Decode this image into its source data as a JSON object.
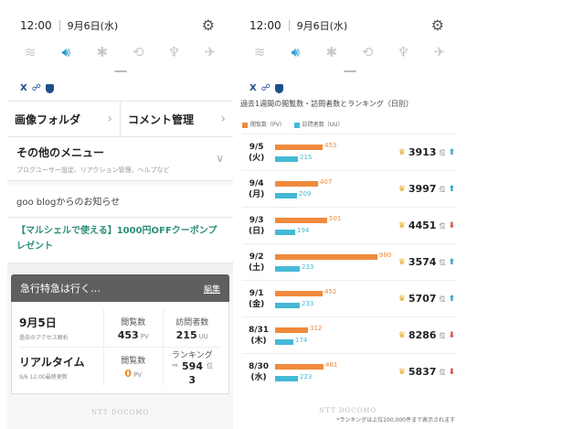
{
  "status": {
    "time": "12:00",
    "date": "9月6日(水)"
  },
  "quick_icons": [
    {
      "name": "wifi-icon",
      "glyph": "≋",
      "on": false
    },
    {
      "name": "sound-icon",
      "glyph": "🔊︎",
      "on": true
    },
    {
      "name": "bluetooth-icon",
      "glyph": "✱",
      "on": false
    },
    {
      "name": "rotate-icon",
      "glyph": "⟲",
      "on": false
    },
    {
      "name": "flashlight-icon",
      "glyph": "♆",
      "on": false
    },
    {
      "name": "airplane-icon",
      "glyph": "✈",
      "on": false
    }
  ],
  "left": {
    "nav": {
      "image_folder": "画像フォルダ",
      "comment_admin": "コメント管理"
    },
    "other_menu": {
      "title": "その他のメニュー",
      "sub": "ブログユーザー設定、リアクション管理、ヘルプなど"
    },
    "notice_head": "goo blogからのお知らせ",
    "promo": "【マルシェルで使える】1000円OFFクーポンプレゼント",
    "express": {
      "title": "急行特急は行く…",
      "edit": "編集"
    },
    "stats": {
      "date": "9月5日",
      "date_sub": "過去のアクセス解析",
      "views_label": "閲覧数",
      "views": "453",
      "views_unit": "PV",
      "visitors_label": "訪問者数",
      "visitors": "215",
      "visitors_unit": "UU",
      "realtime": "リアルタイム",
      "realtime_sub": "9/6 12:00最終更新",
      "rt_views_label": "閲覧数",
      "rt_views": "0",
      "rt_views_unit": "PV",
      "ranking_label": "ランキング",
      "ranking": "594",
      "ranking_extra": "3",
      "ranking_unit": "位"
    }
  },
  "right": {
    "title": "過去1週間の閲覧数・訪問者数とランキング（日別）",
    "legend_pv": "閲覧数（PV）",
    "legend_uu": "訪問者数（UU）",
    "rank_unit": "位",
    "footnote": "*ランキングは上位100,000件まで表示されます",
    "colors": {
      "pv": "#f08a3c",
      "uu": "#44b9d6",
      "up": "#2aa6c7",
      "down": "#e04a3c"
    }
  },
  "watermark": "NTT DOCOMO",
  "chart_data": {
    "type": "bar",
    "title": "過去1週間の閲覧数・訪問者数とランキング（日別）",
    "categories": [
      "9/5(火)",
      "9/4(月)",
      "9/3(日)",
      "9/2(土)",
      "9/1(金)",
      "8/31(木)",
      "8/30(水)"
    ],
    "series": [
      {
        "name": "閲覧数（PV）",
        "values": [
          453,
          407,
          501,
          980,
          452,
          312,
          461
        ]
      },
      {
        "name": "訪問者数（UU）",
        "values": [
          215,
          209,
          194,
          233,
          233,
          174,
          223
        ]
      }
    ],
    "rankings": [
      {
        "rank": "3913",
        "trend": "up"
      },
      {
        "rank": "3997",
        "trend": "up"
      },
      {
        "rank": "4451",
        "trend": "down"
      },
      {
        "rank": "3574",
        "trend": "up"
      },
      {
        "rank": "5707",
        "trend": "up"
      },
      {
        "rank": "8286",
        "trend": "down"
      },
      {
        "rank": "5837",
        "trend": "down"
      }
    ],
    "xlim": [
      0,
      980
    ]
  }
}
